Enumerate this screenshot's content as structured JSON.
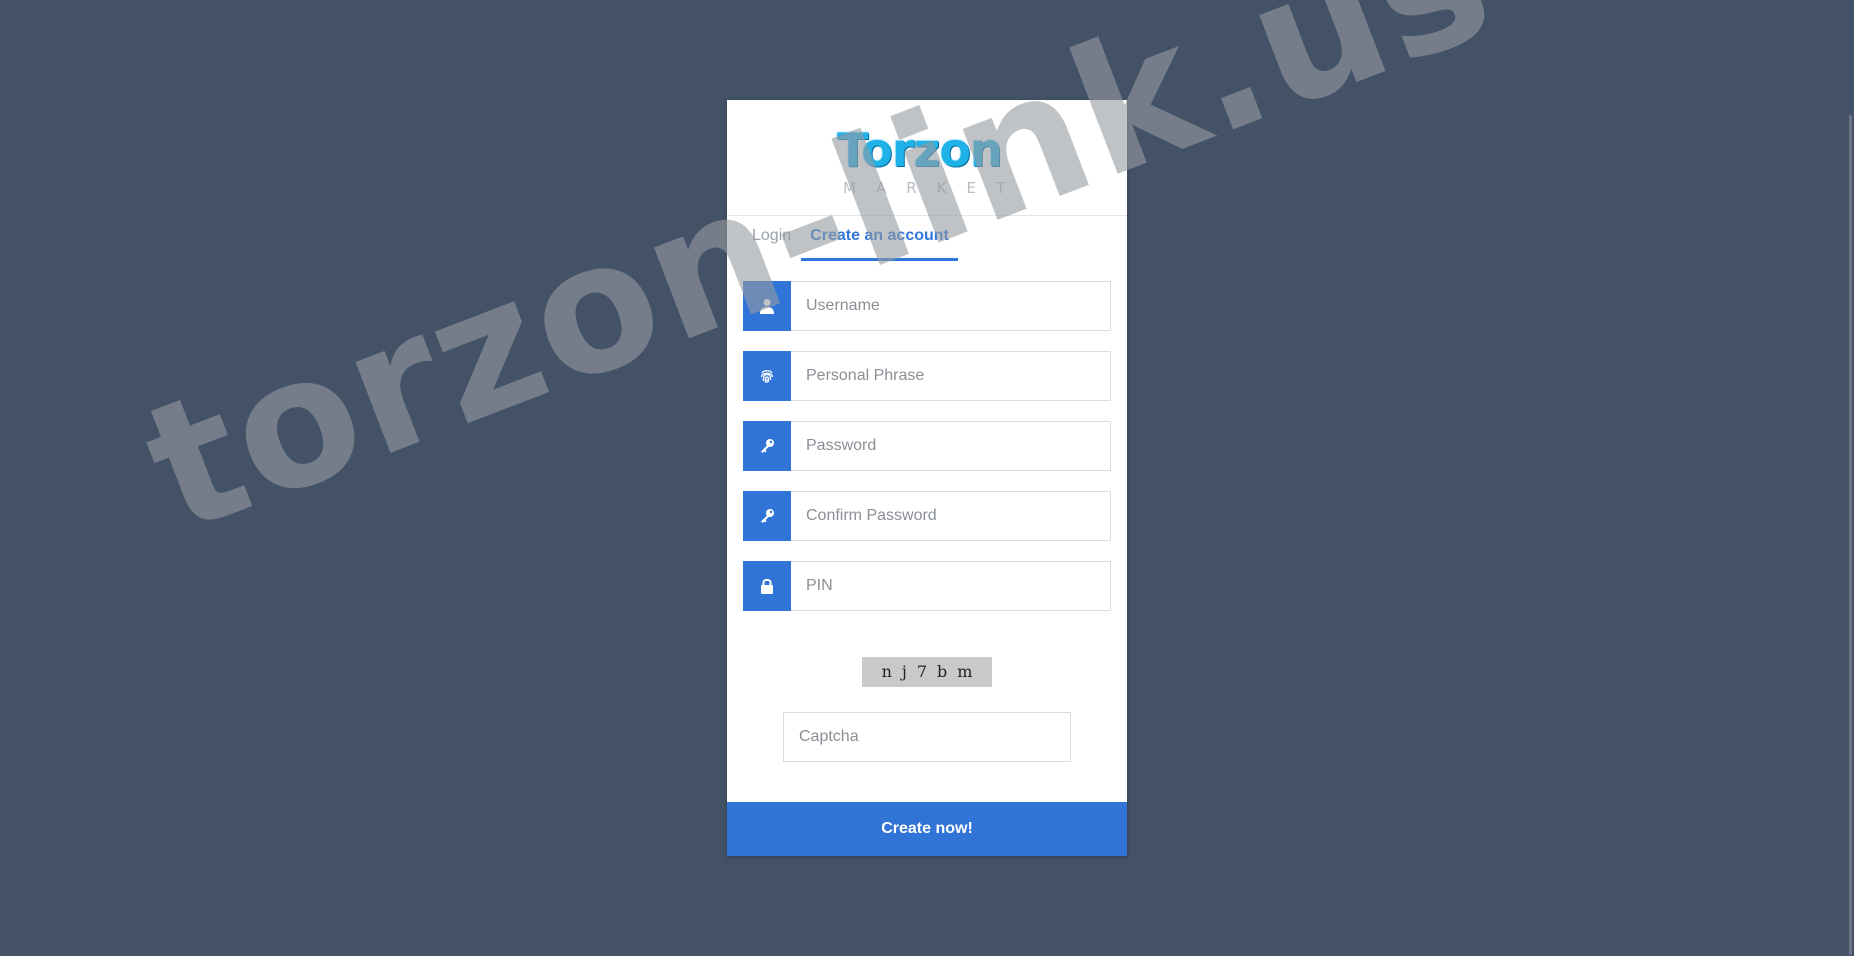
{
  "logo": {
    "word": "Torzon",
    "sub": "MARKET"
  },
  "tabs": [
    {
      "label": "Login",
      "active": false
    },
    {
      "label": "Create an account",
      "active": true
    }
  ],
  "form": {
    "fields": [
      {
        "placeholder": "Username",
        "icon": "user-icon"
      },
      {
        "placeholder": "Personal Phrase",
        "icon": "fingerprint-icon"
      },
      {
        "placeholder": "Password",
        "icon": "key-icon"
      },
      {
        "placeholder": "Confirm Password",
        "icon": "key-icon"
      },
      {
        "placeholder": "PIN",
        "icon": "lock-icon"
      }
    ],
    "captcha_text": "nj7bm",
    "captcha_placeholder": "Captcha",
    "submit_label": "Create now!"
  },
  "watermark": "torzon-link.us",
  "colors": {
    "background": "#435266",
    "accent": "#2f74d6",
    "card": "#ffffff"
  }
}
